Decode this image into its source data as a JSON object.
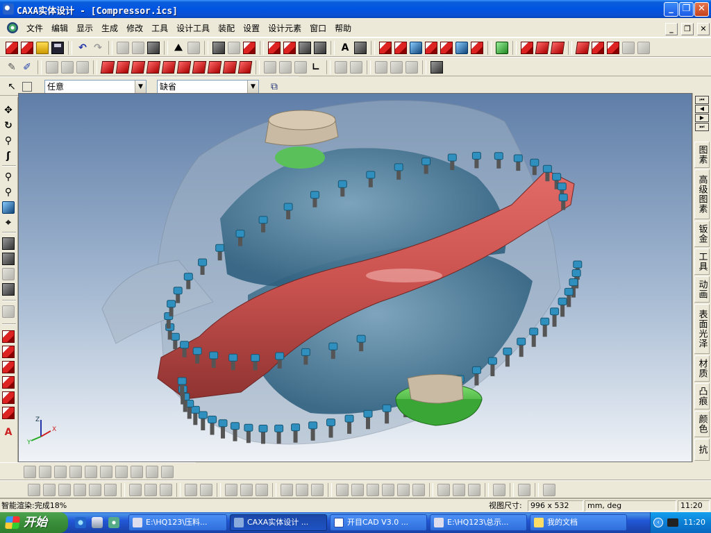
{
  "window": {
    "title": "CAXA实体设计 - [Compressor.ics]",
    "controls": {
      "minimize": "_",
      "restore": "❐",
      "close": "✕"
    }
  },
  "menu": {
    "items": [
      "文件",
      "编辑",
      "显示",
      "生成",
      "修改",
      "工具",
      "设计工具",
      "装配",
      "设置",
      "设计元素",
      "窗口",
      "帮助"
    ],
    "mdi_controls": {
      "minimize": "_",
      "restore": "❐",
      "close": "✕"
    }
  },
  "selection_toolbar": {
    "filter_value": "任意",
    "mode_value": "缺省"
  },
  "right_panel": {
    "nav_buttons": [
      "⏮",
      "◀",
      "▶",
      "⏭"
    ],
    "tabs": [
      "图素",
      "高级图素",
      "钣金",
      "工具",
      "动画",
      "表面光泽",
      "材质",
      "凸痕",
      "颜色",
      "抗"
    ]
  },
  "viewport": {
    "axis_labels": {
      "x": "X",
      "y": "Y",
      "z": "Z"
    },
    "background_top": "#5f7ea8",
    "background_bottom": "#f0f3f7",
    "flange_color": "#c9524f",
    "bolt_head_color": "#2f8fbf",
    "hub_color": "#55c04a"
  },
  "statusbar": {
    "message": "智能渲染:完成18%",
    "viewport_size_label": "视图尺寸:",
    "viewport_size_value": "996 x 532",
    "units": "mm, deg",
    "time": "11:20"
  },
  "taskbar": {
    "start_label": "开始",
    "tasks": [
      {
        "label": "E:\\HQ123\\压料...",
        "active": false
      },
      {
        "label": "CAXA实体设计 ...",
        "active": true
      },
      {
        "label": "开目CAD V3.0 ...",
        "active": false
      },
      {
        "label": "E:\\HQ123\\总示...",
        "active": false
      },
      {
        "label": "我的文档",
        "active": false
      }
    ],
    "clock": "11:20"
  }
}
